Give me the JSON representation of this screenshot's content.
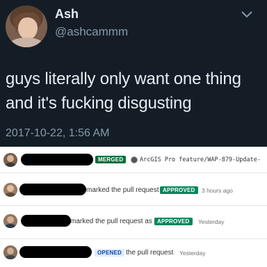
{
  "tweet": {
    "display_name": "Ash",
    "handle": "@ashcammm",
    "text_line1": "guys literally only want one thing",
    "text_line2": "and it's fucking disgusting",
    "timestamp": "2017-10-22, 1:56 AM",
    "colors": {
      "background": "#141d26",
      "text": "#e6ecf0",
      "muted": "#8899a6"
    }
  },
  "activity": {
    "rows": [
      {
        "badge": "MERGED",
        "branch": "ArcGIS Pro feature/WAP-879-Update-"
      },
      {
        "action": "marked the pull request as",
        "badge": "APPROVED",
        "time": "3 hours ago"
      },
      {
        "action": "marked the pull request as",
        "badge": "APPROVED",
        "time": "Yesterday"
      },
      {
        "badge": "OPENED",
        "action": "the pull request",
        "time": "Yesterday"
      }
    ],
    "colors": {
      "merged": "#0a6e3a",
      "approved": "#00875a",
      "opened_bg": "#deebff",
      "opened_text": "#0747a6"
    }
  }
}
